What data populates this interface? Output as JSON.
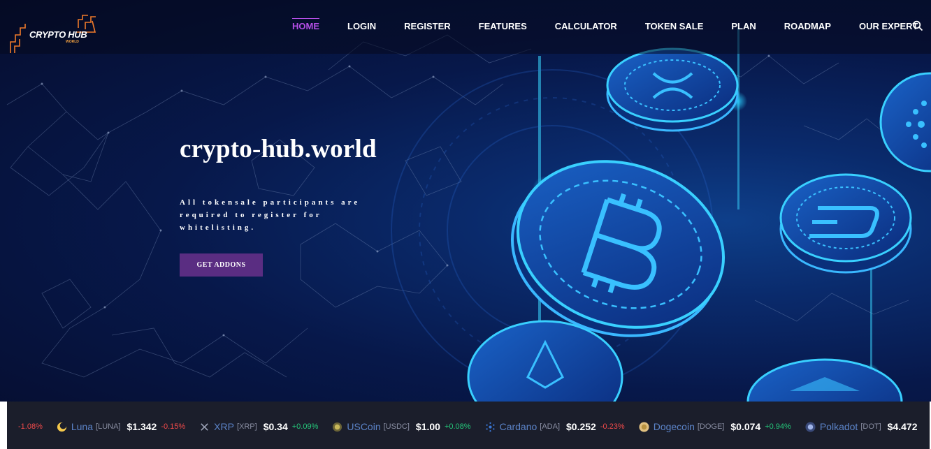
{
  "site": {
    "logo_text": "CRYPTO HUB",
    "logo_sub": "WORLD"
  },
  "nav": {
    "items": [
      {
        "label": "HOME",
        "active": true
      },
      {
        "label": "LOGIN"
      },
      {
        "label": "REGISTER"
      },
      {
        "label": "FEATURES"
      },
      {
        "label": "CALCULATOR"
      },
      {
        "label": "TOKEN SALE"
      },
      {
        "label": "PLAN"
      },
      {
        "label": "ROADMAP"
      },
      {
        "label": "OUR EXPERT"
      }
    ],
    "search_icon": "search-icon",
    "active_color": "#b44ee6"
  },
  "hero": {
    "title": "crypto-hub.world",
    "description": "All tokensale participants are required to register for whitelisting.",
    "button_label": "GET ADDONS",
    "button_color": "#5a2d82"
  },
  "ticker": {
    "leading_change": "-1.08%",
    "items": [
      {
        "name": "Luna",
        "symbol": "[LUNA]",
        "price": "$1.342",
        "change": "-0.15%",
        "icon": "luna-icon"
      },
      {
        "name": "XRP",
        "symbol": "[XRP]",
        "price": "$0.34",
        "change": "+0.09%",
        "icon": "xrp-icon"
      },
      {
        "name": "USCoin",
        "symbol": "[USDC]",
        "price": "$1.00",
        "change": "+0.08%",
        "icon": "usdc-icon"
      },
      {
        "name": "Cardano",
        "symbol": "[ADA]",
        "price": "$0.252",
        "change": "-0.23%",
        "icon": "cardano-icon"
      },
      {
        "name": "Dogecoin",
        "symbol": "[DOGE]",
        "price": "$0.074",
        "change": "+0.94%",
        "icon": "dogecoin-icon"
      },
      {
        "name": "Polkadot",
        "symbol": "[DOT]",
        "price": "$4.472",
        "change": "",
        "icon": "polkadot-icon"
      }
    ],
    "negative_color": "#f04a4a",
    "positive_color": "#25c77a"
  }
}
